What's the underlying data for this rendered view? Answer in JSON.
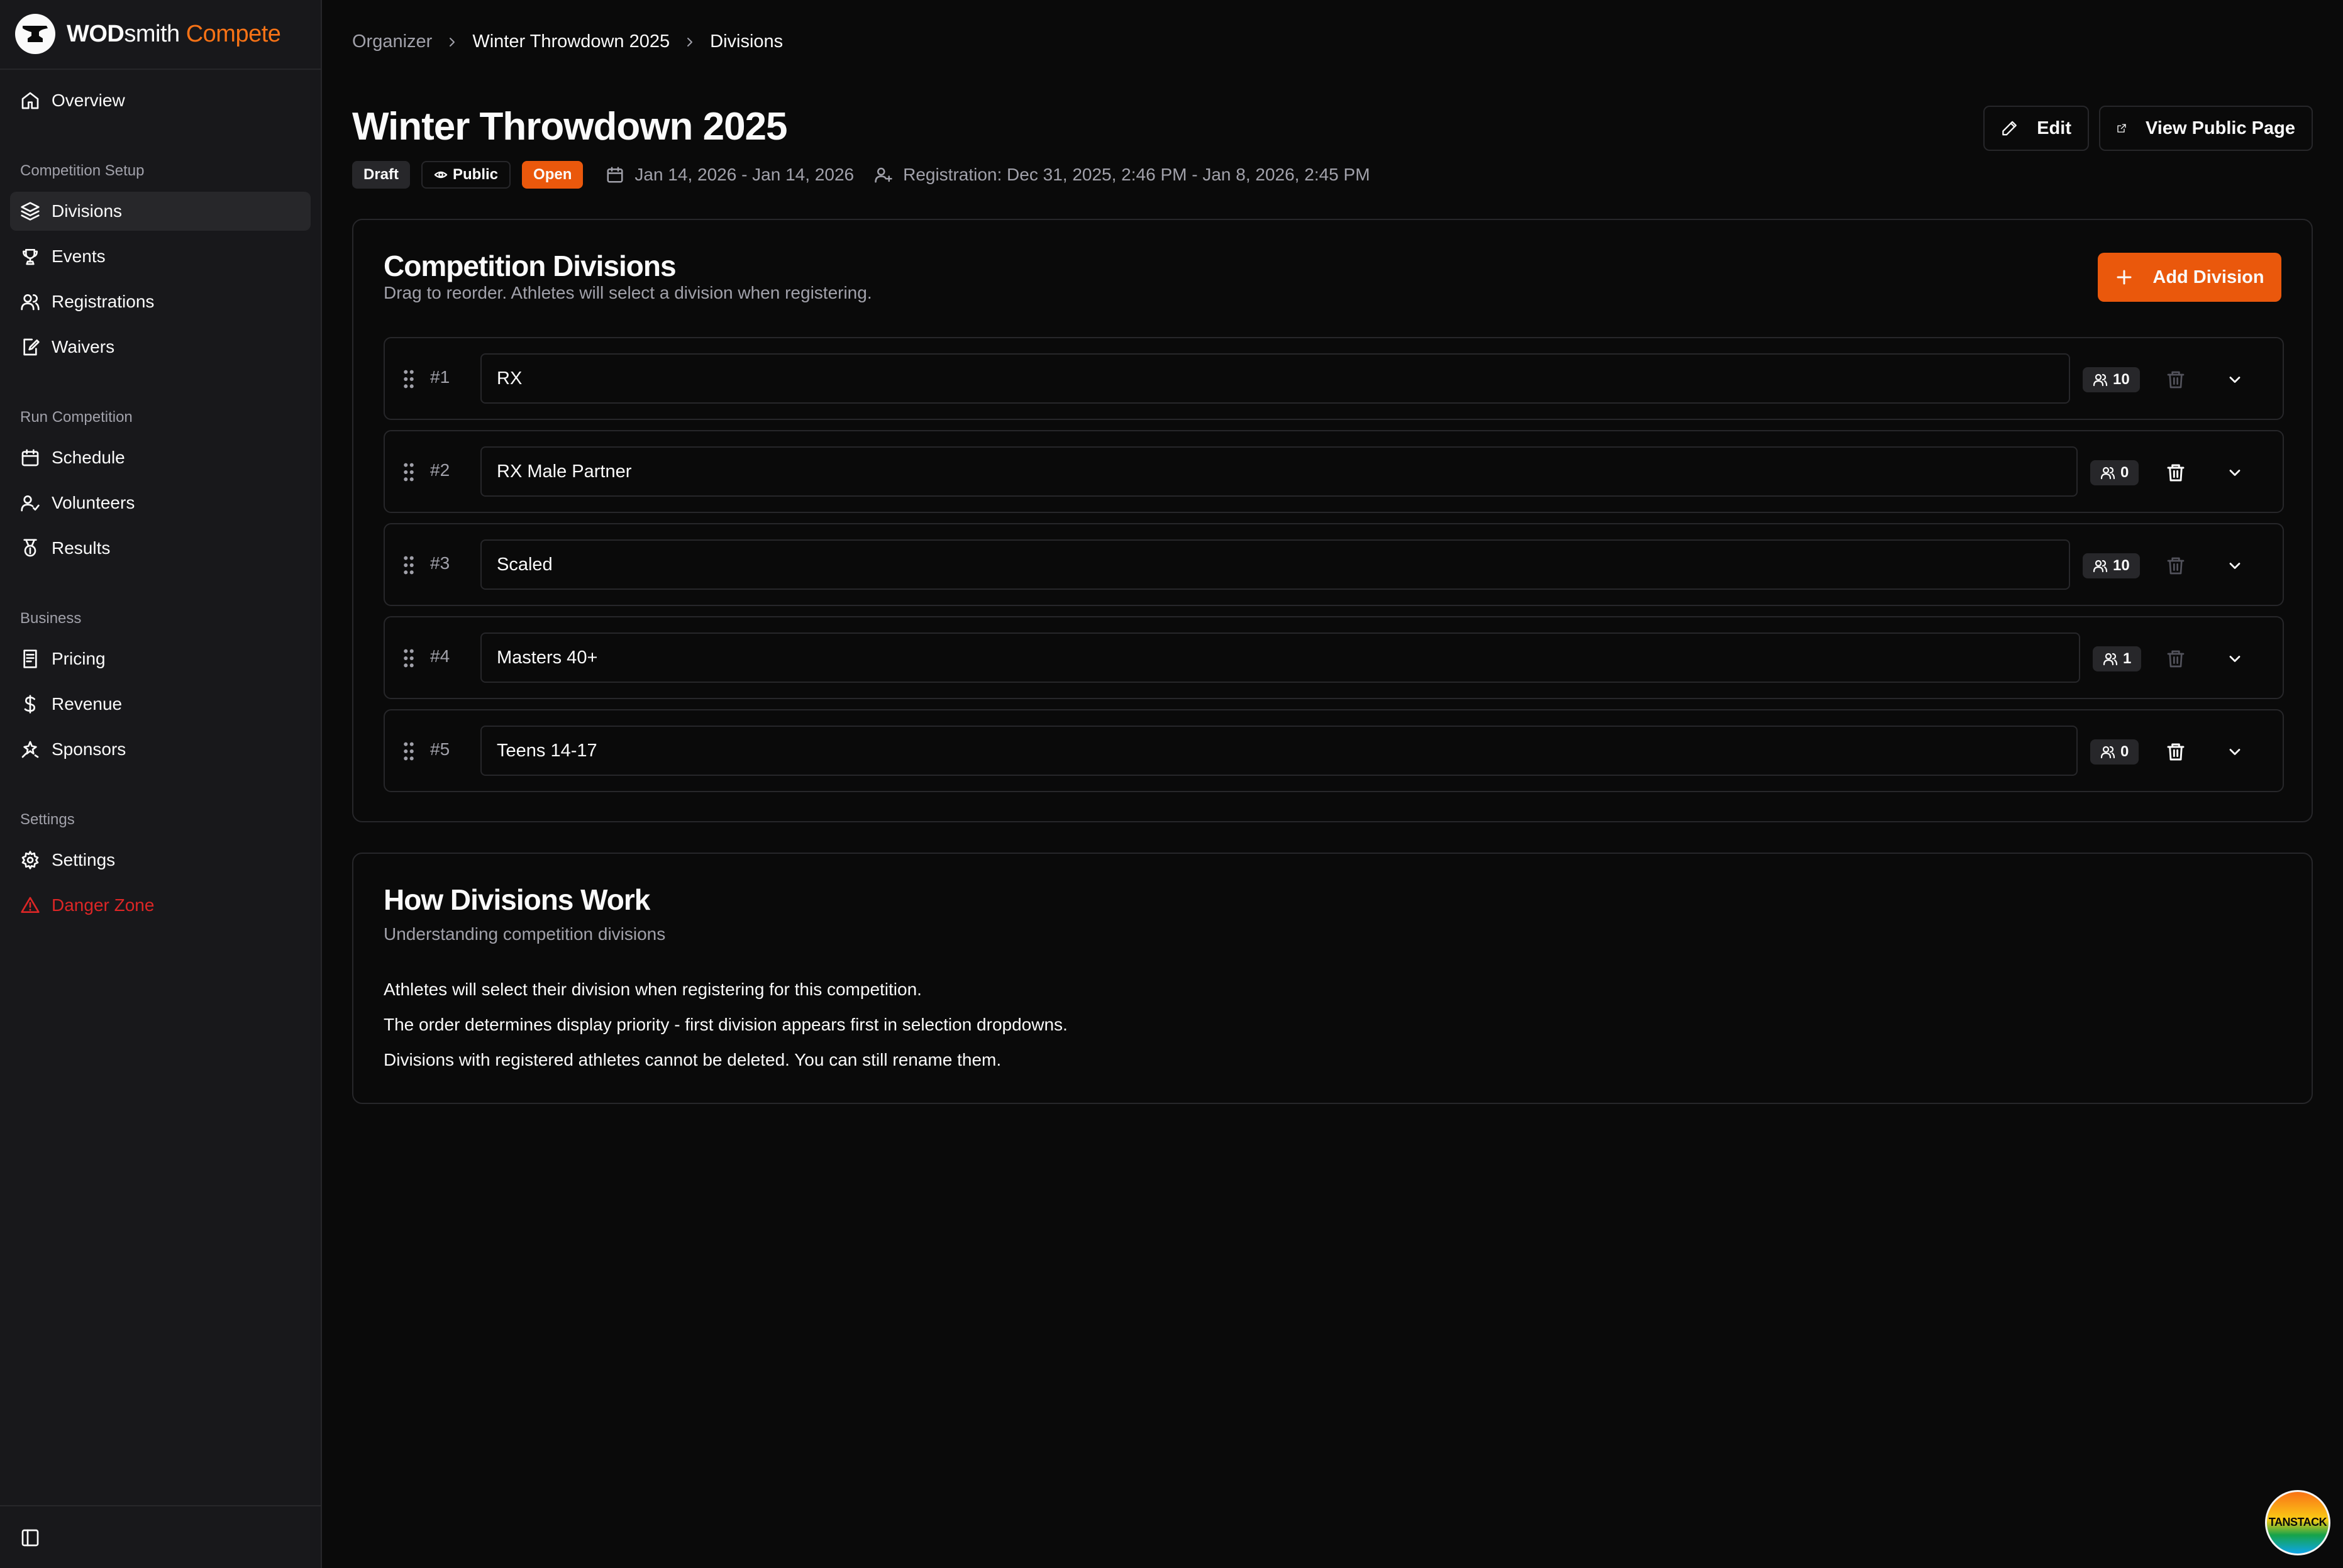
{
  "brand": {
    "name_bold": "WOD",
    "name_light": "smith",
    "name_accent": "Compete"
  },
  "sidebar": {
    "overview": "Overview",
    "groups": {
      "setup": "Competition Setup",
      "run": "Run Competition",
      "business": "Business",
      "settings": "Settings"
    },
    "items": {
      "divisions": "Divisions",
      "events": "Events",
      "registrations": "Registrations",
      "waivers": "Waivers",
      "schedule": "Schedule",
      "volunteers": "Volunteers",
      "results": "Results",
      "pricing": "Pricing",
      "revenue": "Revenue",
      "sponsors": "Sponsors",
      "settings": "Settings",
      "danger": "Danger Zone"
    },
    "active": "divisions"
  },
  "breadcrumb": [
    "Organizer",
    "Winter Throwdown 2025",
    "Divisions"
  ],
  "page": {
    "title": "Winter Throwdown 2025",
    "badges": {
      "draft": "Draft",
      "public": "Public",
      "open": "Open"
    },
    "dates": "Jan 14, 2026 - Jan 14, 2026",
    "registration": "Registration: Dec 31, 2025, 2:46 PM - Jan 8, 2026, 2:45 PM",
    "edit_label": "Edit",
    "view_public_label": "View Public Page"
  },
  "divisions_card": {
    "title": "Competition Divisions",
    "subtitle": "Drag to reorder. Athletes will select a division when registering.",
    "add_label": "Add Division",
    "rows": [
      {
        "num": "#1",
        "name": "RX",
        "count": "10",
        "deletable": false
      },
      {
        "num": "#2",
        "name": "RX Male Partner",
        "count": "0",
        "deletable": true
      },
      {
        "num": "#3",
        "name": "Scaled",
        "count": "10",
        "deletable": false
      },
      {
        "num": "#4",
        "name": "Masters 40+",
        "count": "1",
        "deletable": false
      },
      {
        "num": "#5",
        "name": "Teens 14-17",
        "count": "0",
        "deletable": true
      }
    ]
  },
  "info_card": {
    "title": "How Divisions Work",
    "subtitle": "Understanding competition divisions",
    "lines": [
      "Athletes will select their division when registering for this competition.",
      "The order determines display priority - first division appears first in selection dropdowns.",
      "Divisions with registered athletes cannot be deleted. You can still rename them."
    ]
  },
  "devtools": {
    "label": "TANSTACK"
  },
  "colors": {
    "accent": "#ea580c",
    "danger": "#dc2626",
    "bg": "#0a0a0a",
    "sidebar": "#18181b",
    "border": "#27272a",
    "muted": "#a1a1aa"
  }
}
